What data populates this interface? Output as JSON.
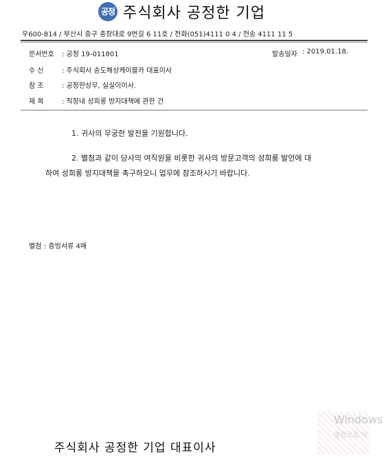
{
  "header": {
    "logo_text": "공정",
    "company_name": "주식회사  공정한 기업",
    "address_line": "우600-814 / 부산시 중구 충장대로 9번길    6 11호 / 전화(051)4111 0 4 / 전송 4111 11 5"
  },
  "meta": {
    "doc_number_label": "문서번호",
    "doc_number_value": ": 공정 19-011801",
    "sent_date_label": "발송일자",
    "sent_date_value": ": 2019.01.18.",
    "recipient_label": "수    신",
    "recipient_value": ": 주식회사 송도해상케이블카 대표이사",
    "reference_label": "참    조",
    "reference_value": ": 공정한상무, 실실이이사.",
    "subject_label": "제    목",
    "subject_value": ": 직장내 성희롱 방지대책에 관한 건"
  },
  "body": {
    "para1": "1. 귀사의 무궁한 발전을 기원합니다.",
    "para2_line1": "2. 별첨과 같이 당사의 여직원을 비롯한 귀사의 방문고객의 성희롱 발언에 대",
    "para2_line2": "하여 성희롱 방지대책을 촉구하오니 업무에 참조하시기 바랍니다."
  },
  "attachment": {
    "label": "별첨",
    "value": ": 증빙서류 4매"
  },
  "footer": {
    "signature": "주식회사 공정한 기업   대표이사",
    "watermark_line1": "Windows",
    "watermark_line2": "설정으로 이"
  },
  "colors": {
    "logo_blue": "#3f6fb5"
  }
}
